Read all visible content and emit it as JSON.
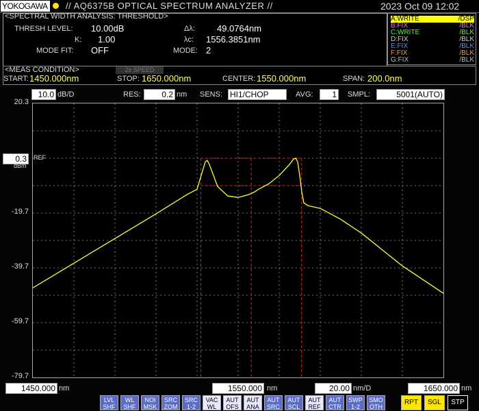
{
  "header": {
    "logo": "YOKOGAWA",
    "title": "// AQ6375B OPTICAL SPECTRUM ANALYZER //",
    "date": "2023 Oct 09 12:02"
  },
  "analysis": {
    "heading": "<SPECTRAL WIDTH ANALYSIS: THRESHOLD>",
    "thresh_label": "THRESH LEVEL:",
    "thresh_value": "10.00dB",
    "k_label": "K:",
    "k_value": "1.00",
    "modefit_label": "MODE FIT:",
    "modefit_value": "OFF",
    "dl_label": "Δλ:",
    "dl_value": "49.0764nm",
    "lc_label": "λc:",
    "lc_value": "1556.3851nm",
    "mode_label": "MODE:",
    "mode_value": "2"
  },
  "traces": [
    {
      "a": "A:WRITE",
      "b": "/DSP",
      "color": "#ffff00",
      "active": true
    },
    {
      "a": "B:FIX",
      "b": "/BLK",
      "color": "#ff66ff",
      "active": false
    },
    {
      "a": "C:WRITE",
      "b": "/BLK",
      "color": "#44ff44",
      "active": false
    },
    {
      "a": "D:FIX",
      "b": "/BLK",
      "color": "#cccccc",
      "active": false
    },
    {
      "a": "E:FIX",
      "b": "/BLK",
      "color": "#6688ff",
      "active": false
    },
    {
      "a": "F:FIX",
      "b": "/BLK",
      "color": "#ff9933",
      "active": false
    },
    {
      "a": "G:FIX",
      "b": "/BLK",
      "color": "#bbbbbb",
      "active": false
    }
  ],
  "meas": {
    "heading": "<MEAS CONDITION>",
    "speed": "2x SPEED",
    "start_label": "START:",
    "start_value": "1450.000nm",
    "stop_label": "STOP:",
    "stop_value": "1650.000nm",
    "center_label": "CENTER:",
    "center_value": "1550.000nm",
    "span_label": "SPAN:",
    "span_value": "200.0nm"
  },
  "settings": {
    "scale_value": "10.0",
    "scale_unit": "dB/D",
    "res_label": "RES:",
    "res_value": "0.2",
    "res_unit": "nm",
    "sens_label": "SENS:",
    "sens_value": "HI1/CHOP",
    "avg_label": "AVG:",
    "avg_value": "1",
    "smpl_label": "SMPL:",
    "smpl_value": "5001(AUTO)"
  },
  "yaxis": {
    "ticks": [
      "20.3",
      "0.3",
      "-19.7",
      "-39.7",
      "-59.7",
      "-79.7"
    ],
    "ref_value": "0.3",
    "ref_label": "REF",
    "ref_unit": "dBm"
  },
  "xaxis": {
    "start": "1450.000",
    "start_unit": "nm",
    "center": "1550.000",
    "center_unit": "nm",
    "div": "20.00",
    "div_unit": "nm/D",
    "stop": "1650.000",
    "stop_unit": "nm"
  },
  "softkeys": [
    {
      "l1": "LVL",
      "l2": "SHF",
      "on": false
    },
    {
      "l1": "WL",
      "l2": "SHF",
      "on": false
    },
    {
      "l1": "NOI",
      "l2": "MSK",
      "on": false
    },
    {
      "l1": "SRC",
      "l2": "ZOM",
      "on": false
    },
    {
      "l1": "SRC",
      "l2": "1-2",
      "on": false
    },
    {
      "l1": "VAC",
      "l2": "WL",
      "on": true
    },
    {
      "l1": "AUT",
      "l2": "OFS",
      "on": true
    },
    {
      "l1": "AUT",
      "l2": "ANA",
      "on": true
    },
    {
      "l1": "AUT",
      "l2": "SRC",
      "on": false
    },
    {
      "l1": "AUT",
      "l2": "SCL",
      "on": false
    },
    {
      "l1": "AUT",
      "l2": "REF",
      "on": true
    },
    {
      "l1": "AUT",
      "l2": "CTR",
      "on": false
    },
    {
      "l1": "SWP",
      "l2": "1-2",
      "on": false
    },
    {
      "l1": "SMO",
      "l2": "OTH",
      "on": false
    }
  ],
  "runkeys": [
    "RPT",
    "SGL",
    "STP"
  ],
  "chart_data": {
    "type": "line",
    "xlim": [
      1450,
      1650
    ],
    "ylim": [
      -79.7,
      20.3
    ],
    "xlabel": "",
    "ylabel": "",
    "series": [
      {
        "points": [
          [
            1450,
            -47
          ],
          [
            1470,
            -38
          ],
          [
            1490,
            -29
          ],
          [
            1510,
            -20
          ],
          [
            1525,
            -13
          ],
          [
            1530,
            -11
          ],
          [
            1532,
            -6
          ],
          [
            1534,
            -1
          ],
          [
            1535,
            -0.5
          ],
          [
            1536,
            -2
          ],
          [
            1538,
            -6
          ],
          [
            1540,
            -10
          ],
          [
            1545,
            -13.5
          ],
          [
            1550,
            -14
          ],
          [
            1555,
            -13
          ],
          [
            1558,
            -12
          ],
          [
            1560,
            -11
          ],
          [
            1565,
            -9
          ],
          [
            1570,
            -6
          ],
          [
            1575,
            -2
          ],
          [
            1577,
            0
          ],
          [
            1578,
            0.3
          ],
          [
            1579,
            -1
          ],
          [
            1580,
            -6
          ],
          [
            1581,
            -12
          ],
          [
            1582,
            -16
          ],
          [
            1584,
            -17
          ],
          [
            1590,
            -18
          ],
          [
            1600,
            -22
          ],
          [
            1610,
            -27
          ],
          [
            1620,
            -33
          ],
          [
            1630,
            -39
          ],
          [
            1640,
            -44
          ],
          [
            1650,
            -49
          ]
        ]
      }
    ],
    "markers": {
      "x1": 1531.8,
      "x2": 1580.9,
      "center": 1556.4,
      "y_peak": 0.3,
      "y_thresh": -9.7
    }
  }
}
